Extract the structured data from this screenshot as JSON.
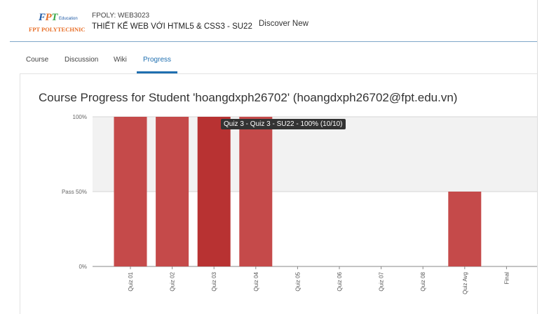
{
  "header": {
    "logo_top": "FPT",
    "logo_sub": "Education",
    "logo_bottom": "FPT POLYTECHNIC",
    "course_org": "FPOLY: WEB3023",
    "course_name": "THIẾT KẾ WEB VỚI HTML5 & CSS3 - SU22",
    "discover_label": "Discover New"
  },
  "tabs": [
    {
      "label": "Course"
    },
    {
      "label": "Discussion"
    },
    {
      "label": "Wiki"
    },
    {
      "label": "Progress",
      "active": true
    }
  ],
  "page_title": "Course Progress for Student 'hoangdxph26702' (hoangdxph26702@fpt.edu.vn)",
  "tooltip": "Quiz 3 - Quiz 3 - SU22 - 100% (10/10)",
  "colors": {
    "bar": "#c54a4a",
    "bar_hover": "#b83232",
    "pass_band": "#f2f2f2",
    "accent": "#1f6fb0"
  },
  "chart_data": {
    "type": "bar",
    "categories": [
      "Quiz 01",
      "Quiz 02",
      "Quiz 03",
      "Quiz 04",
      "Quiz 05",
      "Quiz 06",
      "Quiz 07",
      "Quiz 08",
      "Quiz Avg",
      "Final"
    ],
    "values": [
      100,
      100,
      100,
      100,
      0,
      0,
      0,
      0,
      50,
      0
    ],
    "ylim": [
      0,
      100
    ],
    "y_ticks": [
      {
        "value": 100,
        "label": "100%"
      },
      {
        "value": 50,
        "label": "Pass 50%"
      },
      {
        "value": 0,
        "label": "0%"
      }
    ],
    "pass_threshold": 50,
    "highlighted": "Quiz 03"
  }
}
